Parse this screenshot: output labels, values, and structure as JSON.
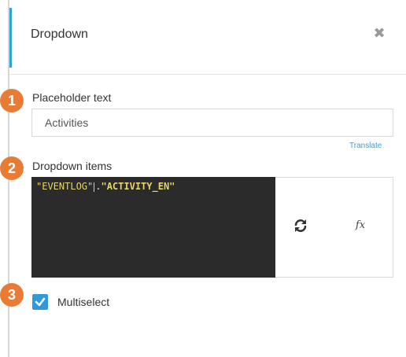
{
  "header": {
    "title": "Dropdown",
    "close_icon": "close-icon"
  },
  "steps": [
    "1",
    "2",
    "3"
  ],
  "placeholder_section": {
    "label": "Placeholder text",
    "value": "Activities",
    "translate_link": "Translate"
  },
  "items_section": {
    "label": "Dropdown items",
    "code_part1": "\"EVENTLOG\"",
    "code_dot": ".",
    "code_part2": "\"ACTIVITY_EN\"",
    "refresh_icon": "refresh-icon",
    "formula_icon": "fx"
  },
  "multiselect": {
    "label": "Multiselect",
    "checked": true
  },
  "colors": {
    "accent": "#2ea3d3",
    "badge": "#e97c35",
    "checkbox": "#2e9bd6",
    "editor_bg": "#2b2b2b"
  }
}
